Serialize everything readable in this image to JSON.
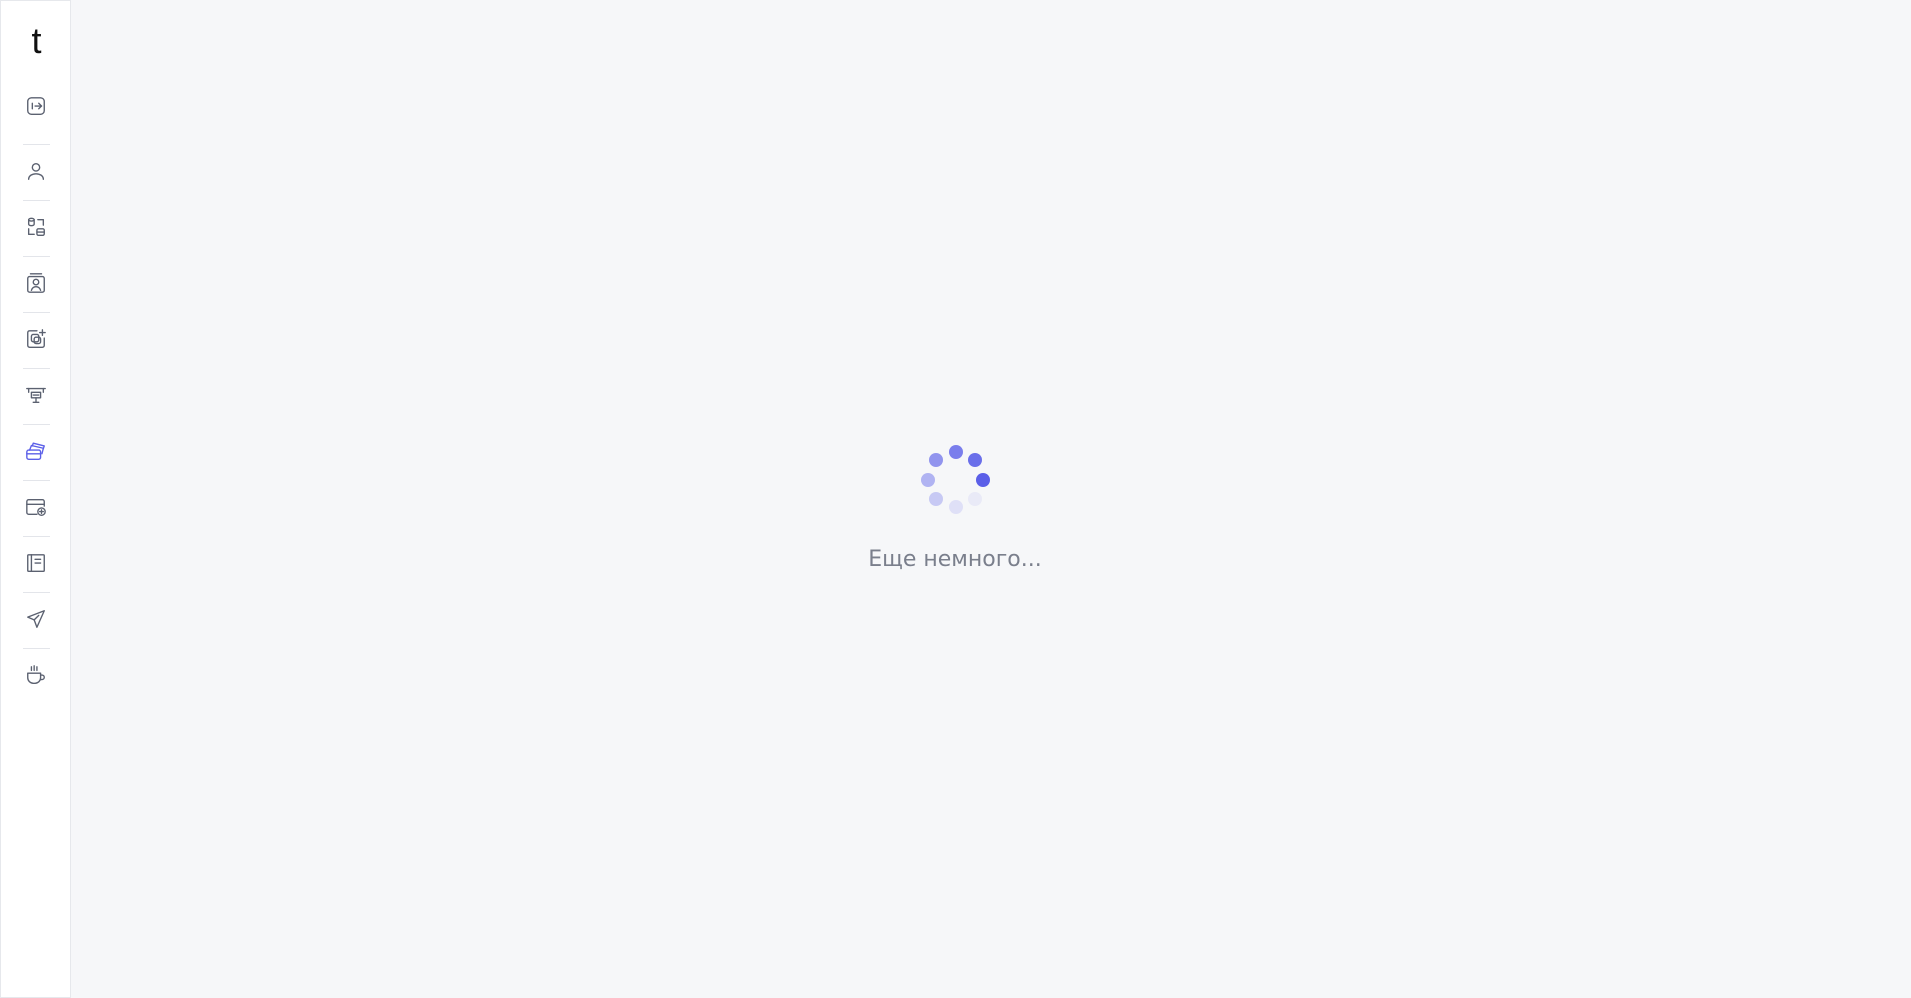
{
  "app": {
    "logo_text": "t"
  },
  "sidebar": {
    "items": [
      {
        "icon": "logout-arrow-icon",
        "active": false
      },
      {
        "icon": "user-icon",
        "active": false
      },
      {
        "icon": "database-layout-icon",
        "active": false
      },
      {
        "icon": "contact-card-icon",
        "active": false
      },
      {
        "icon": "add-gallery-icon",
        "active": false
      },
      {
        "icon": "presentation-board-icon",
        "active": false
      },
      {
        "icon": "cards-icon",
        "active": true
      },
      {
        "icon": "add-card-icon",
        "active": false
      },
      {
        "icon": "notebook-icon",
        "active": false
      },
      {
        "icon": "send-plane-icon",
        "active": false
      },
      {
        "icon": "coffee-cup-icon",
        "active": false
      }
    ],
    "accent_color": "#5b5fe8",
    "icon_color": "#5b6170"
  },
  "loader": {
    "text": "Еще немного...",
    "dot_color": "#5b5fe8"
  }
}
